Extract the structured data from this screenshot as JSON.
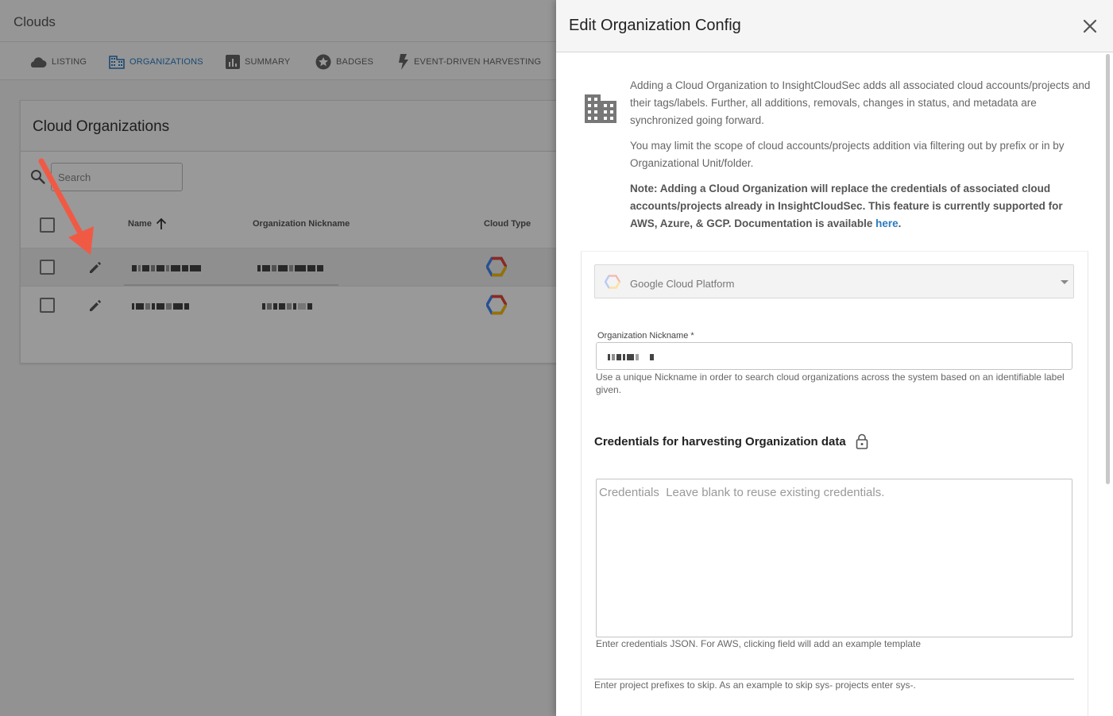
{
  "app": {
    "title": "Clouds",
    "tabs": [
      {
        "label": "LISTING",
        "icon": "cloud-icon"
      },
      {
        "label": "ORGANIZATIONS",
        "icon": "building-icon",
        "active": true
      },
      {
        "label": "SUMMARY",
        "icon": "bar-chart-icon"
      },
      {
        "label": "BADGES",
        "icon": "badge-star-icon"
      },
      {
        "label": "EVENT-DRIVEN HARVESTING",
        "icon": "lightning-icon"
      }
    ]
  },
  "card": {
    "title": "Cloud Organizations",
    "search_placeholder": "Search",
    "columns": [
      "Name",
      "Organization Nickname",
      "Cloud Type"
    ],
    "rows": [
      {
        "cloud_type": "Google Cloud Platform",
        "icon": "gcp-logo-icon"
      },
      {
        "cloud_type": "Google Cloud Platform",
        "icon": "gcp-logo-icon"
      }
    ]
  },
  "drawer": {
    "title": "Edit Organization Config",
    "intro_p1": "Adding a Cloud Organization to InsightCloudSec adds all associated cloud accounts/projects and their tags/labels. Further, all additions, removals, changes in status, and metadata are synchronized going forward.",
    "intro_p2": "You may limit the scope of cloud accounts/projects addition via filtering out by prefix or in by Organizational Unit/folder.",
    "intro_note": "Note: Adding a Cloud Organization will replace the credentials of associated cloud accounts/projects already in InsightCloudSec. This feature is currently supported for AWS, Azure, & GCP. Documentation is available ",
    "intro_link": "here",
    "intro_end": ".",
    "cloud_select": "Google Cloud Platform",
    "nickname_label": "Organization Nickname *",
    "nickname_help": "Use a unique Nickname in order to search cloud organizations across the system based on an identifiable label given.",
    "credentials_title": "Credentials for harvesting Organization data",
    "credentials_placeholder": "Credentials  Leave blank to reuse existing credentials.",
    "credentials_help": "Enter credentials JSON. For AWS, clicking field will add an example template",
    "prefix_help": "Enter project prefixes to skip. As an example to skip sys- projects enter sys-."
  },
  "colors": {
    "accent": "#2a7bbf",
    "annotation_arrow": "#f05a45"
  }
}
